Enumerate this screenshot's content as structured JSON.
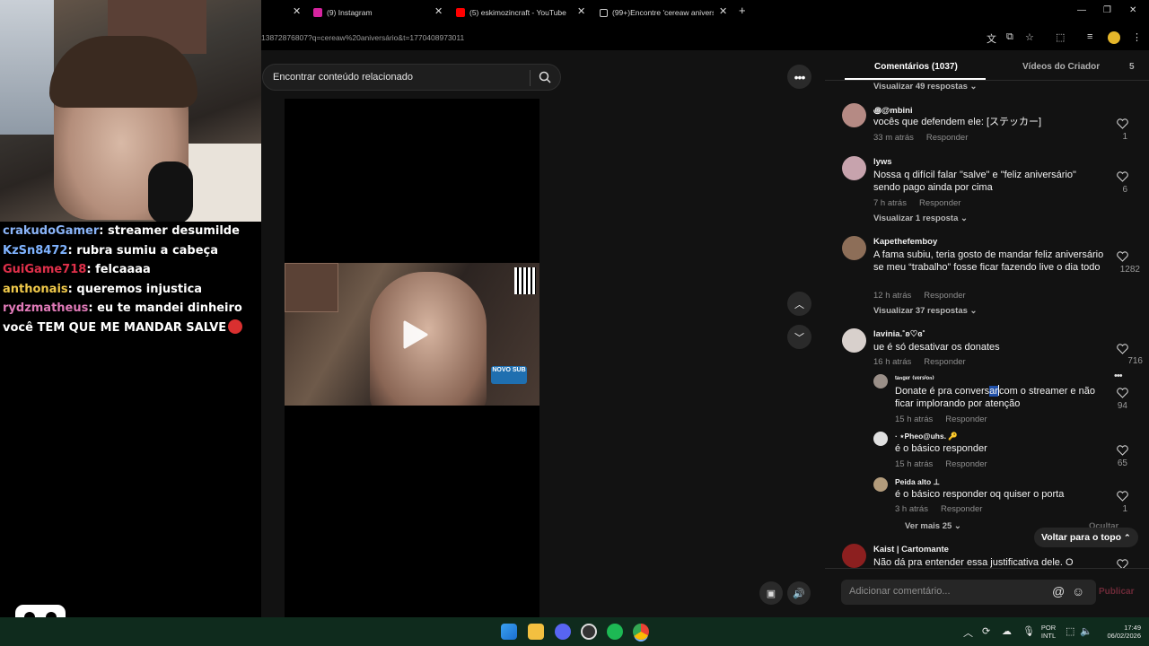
{
  "browser": {
    "tabs": [
      {
        "label": "(9) Instagram",
        "color": "#d6249f"
      },
      {
        "label": "(5) eskimozincraft - YouTube",
        "color": "#ff0000"
      },
      {
        "label": "(99+)Encontre 'cereaw aniversá",
        "color": "#222222"
      }
    ],
    "new_tab": "+",
    "url": "13872876807?q=cereaw%20aniversário&t=1770408973011"
  },
  "stream": {
    "chat": [
      {
        "user": "crakudoGamer",
        "user_color": "#8ab4f8",
        "message": "streamer desumilde"
      },
      {
        "user": "KzSn8472",
        "user_color": "#7fb3ff",
        "message": "rubra sumiu a cabeça"
      },
      {
        "user": "GuiGame718",
        "user_color": "#e0304a",
        "message": "felcaaaa"
      },
      {
        "user": "anthonais",
        "user_color": "#f0c94a",
        "message": "queremos injustica"
      },
      {
        "user": "rydzmatheus",
        "user_color": "#e07ab8",
        "message": "eu te mandei dinheiro"
      }
    ],
    "chat_wrap": "você TEM QUE ME MANDAR SALVE"
  },
  "search": {
    "placeholder": "Encontrar conteúdo relacionado"
  },
  "video_badge": "NOVO SUB",
  "comments_panel": {
    "tab_comments": "Comentários (1037)",
    "tab_creator": "Vídeos do Criador",
    "tab_extra": "5",
    "top_replies": "Visualizar 49 respostas",
    "comments": [
      {
        "user": "꩜@mbini",
        "text": "vocês que defendem ele: [ステッカー]",
        "time": "33 m atrás",
        "reply": "Responder",
        "likes": "1",
        "avatar": "#b58a84"
      },
      {
        "user": "lyws",
        "text": "Nossa q difícil falar \"salve\" e \"feliz aniversário\" sendo pago ainda por cima",
        "time": "7 h atrás",
        "reply": "Responder",
        "likes": "6",
        "replies": "Visualizar 1 resposta",
        "avatar": "#c7a3ad"
      },
      {
        "user": "Kapethefemboy",
        "text": "A fama subiu, teria gosto de mandar feliz aniversário se meu “trabalho” fosse ficar fazendo live o dia todo",
        "time": "12 h atrás",
        "reply": "Responder",
        "likes": "1282",
        "replies": "Visualizar 37 respostas",
        "avatar": "#8d6e58"
      },
      {
        "user": "lavinia.˚ʚ♡ɞ˚",
        "text": "ue é só desativar os donates",
        "time": "16 h atrás",
        "reply": "Responder",
        "likes": "716",
        "avatar": "#d8d0cc"
      }
    ],
    "replies": [
      {
        "user": "ᵗᵃⁿᵍᵉʳ ⁽ᵛᵉʳˢⁱᵒⁿ⁾",
        "text_before": "Donate é pra convers",
        "text_highlight": "ar",
        "text_after": "com o streamer e não ficar implorando por atenção",
        "time": "15 h atrás",
        "reply": "Responder",
        "likes": "94",
        "avatar": "#9a8f88"
      },
      {
        "user": "· ⋆Pheo@uhs. 🔑",
        "text": "é o básico responder",
        "time": "15 h atrás",
        "reply": "Responder",
        "likes": "65",
        "avatar": "#e0e0e0"
      },
      {
        "user": "Peida alto ⊥",
        "text": "é o básico responder oq quiser o porta",
        "time": "3 h atrás",
        "reply": "Responder",
        "likes": "1",
        "avatar": "#b39c7c"
      }
    ],
    "more_replies": "Ver mais 25",
    "hide": "Ocultar",
    "last": {
      "user": "Kaist | Cartomante",
      "text": "Não dá pra entender essa justificativa dele. O",
      "avatar": "#8c1f1f"
    },
    "back_to_top": "Voltar para o topo",
    "add_placeholder": "Adicionar comentário...",
    "publish": "Publicar"
  },
  "taskbar": {
    "lang_top": "POR",
    "lang_bottom": "INTL",
    "time": "17:49",
    "date": "06/02/2026"
  }
}
